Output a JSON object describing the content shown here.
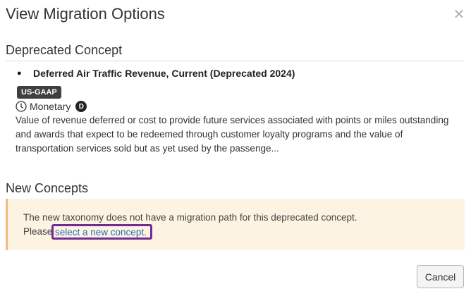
{
  "dialog": {
    "title": "View Migration Options",
    "close_icon": "close-icon"
  },
  "deprecated_section": {
    "heading": "Deprecated Concept",
    "concept": {
      "name": "Deferred Air Traffic Revenue, Current (Deprecated 2024)",
      "taxonomy_badge": "US-GAAP",
      "type_icon": "clock-icon",
      "type_label": "Monetary",
      "balance_badge": "D",
      "description": "Value of revenue deferred or cost to provide future services associated with points or miles outstanding and awards that expect to be redeemed through customer loyalty programs and the value of transportation services sold but as yet used by the passenge..."
    }
  },
  "new_section": {
    "heading": "New Concepts",
    "alert": {
      "message": "The new taxonomy does not have a migration path for this deprecated concept.",
      "prefix": "Please",
      "link_text": "select a new concept."
    }
  },
  "footer": {
    "cancel_label": "Cancel"
  },
  "colors": {
    "alert_bg": "#fdf3e3",
    "alert_border": "#f0b87a",
    "link": "#2a6db5",
    "highlight": "#6f2c91",
    "badge_bg": "#3f3f3f"
  }
}
